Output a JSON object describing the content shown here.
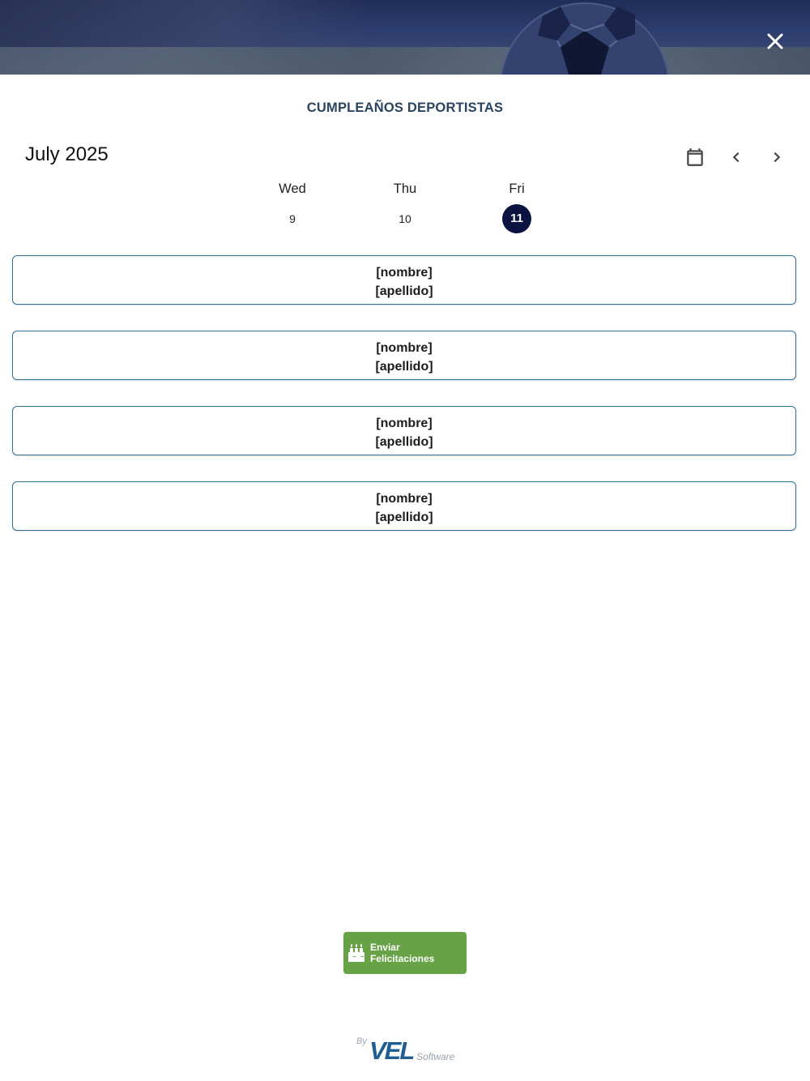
{
  "header": {
    "close_icon": "close-icon",
    "background": "soccer-ball-photo"
  },
  "page": {
    "title": "CUMPLEAÑOS DEPORTISTAS"
  },
  "calendar": {
    "month_label": "July 2025",
    "calendar_icon": "calendar-icon",
    "prev_icon": "chevron-left-icon",
    "next_icon": "chevron-right-icon",
    "days": [
      {
        "name": "Wed",
        "number": "9",
        "selected": false
      },
      {
        "name": "Thu",
        "number": "10",
        "selected": false
      },
      {
        "name": "Fri",
        "number": "11",
        "selected": true
      }
    ],
    "selected_color": "#0b1440"
  },
  "birthdays": [
    {
      "first_name": "[nombre]",
      "last_name": "[apellido]"
    },
    {
      "first_name": "[nombre]",
      "last_name": "[apellido]"
    },
    {
      "first_name": "[nombre]",
      "last_name": "[apellido]"
    },
    {
      "first_name": "[nombre]",
      "last_name": "[apellido]"
    }
  ],
  "actions": {
    "send_label": "Enviar Felicitaciones",
    "send_icon": "cake-icon",
    "send_color": "#67a246"
  },
  "footer": {
    "by": "By",
    "brand": "VEL",
    "suffix": "Software",
    "brand_color": "#1f5d93"
  },
  "colors": {
    "card_border": "#2f6f99",
    "title": "#2a4460"
  }
}
